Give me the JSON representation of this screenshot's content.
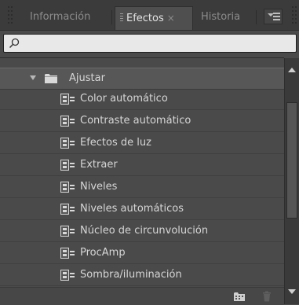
{
  "tabs": [
    {
      "label": "Información"
    },
    {
      "label": "Efectos",
      "close": "×"
    },
    {
      "label": "Historia"
    }
  ],
  "search": {
    "value": "",
    "placeholder": ""
  },
  "tree": {
    "folder": {
      "label": "Ajustar"
    },
    "items": [
      {
        "label": "Color automático"
      },
      {
        "label": "Contraste automático"
      },
      {
        "label": "Efectos de luz"
      },
      {
        "label": "Extraer"
      },
      {
        "label": "Niveles"
      },
      {
        "label": "Niveles automáticos"
      },
      {
        "label": "Núcleo de circunvolución"
      },
      {
        "label": "ProcAmp"
      },
      {
        "label": "Sombra/iluminación"
      }
    ]
  },
  "icons": {
    "search": "search-icon",
    "folder": "folder-icon",
    "effect": "video-effect-icon",
    "panel_menu": "panel-menu-icon",
    "new_bin": "new-bin-icon",
    "delete": "trash-icon"
  },
  "colors": {
    "panel_bg": "#4a4a4a",
    "tab_active_bg": "#4f4f4f",
    "text": "#d6d6d6",
    "search_bg": "#e8e8e8"
  }
}
